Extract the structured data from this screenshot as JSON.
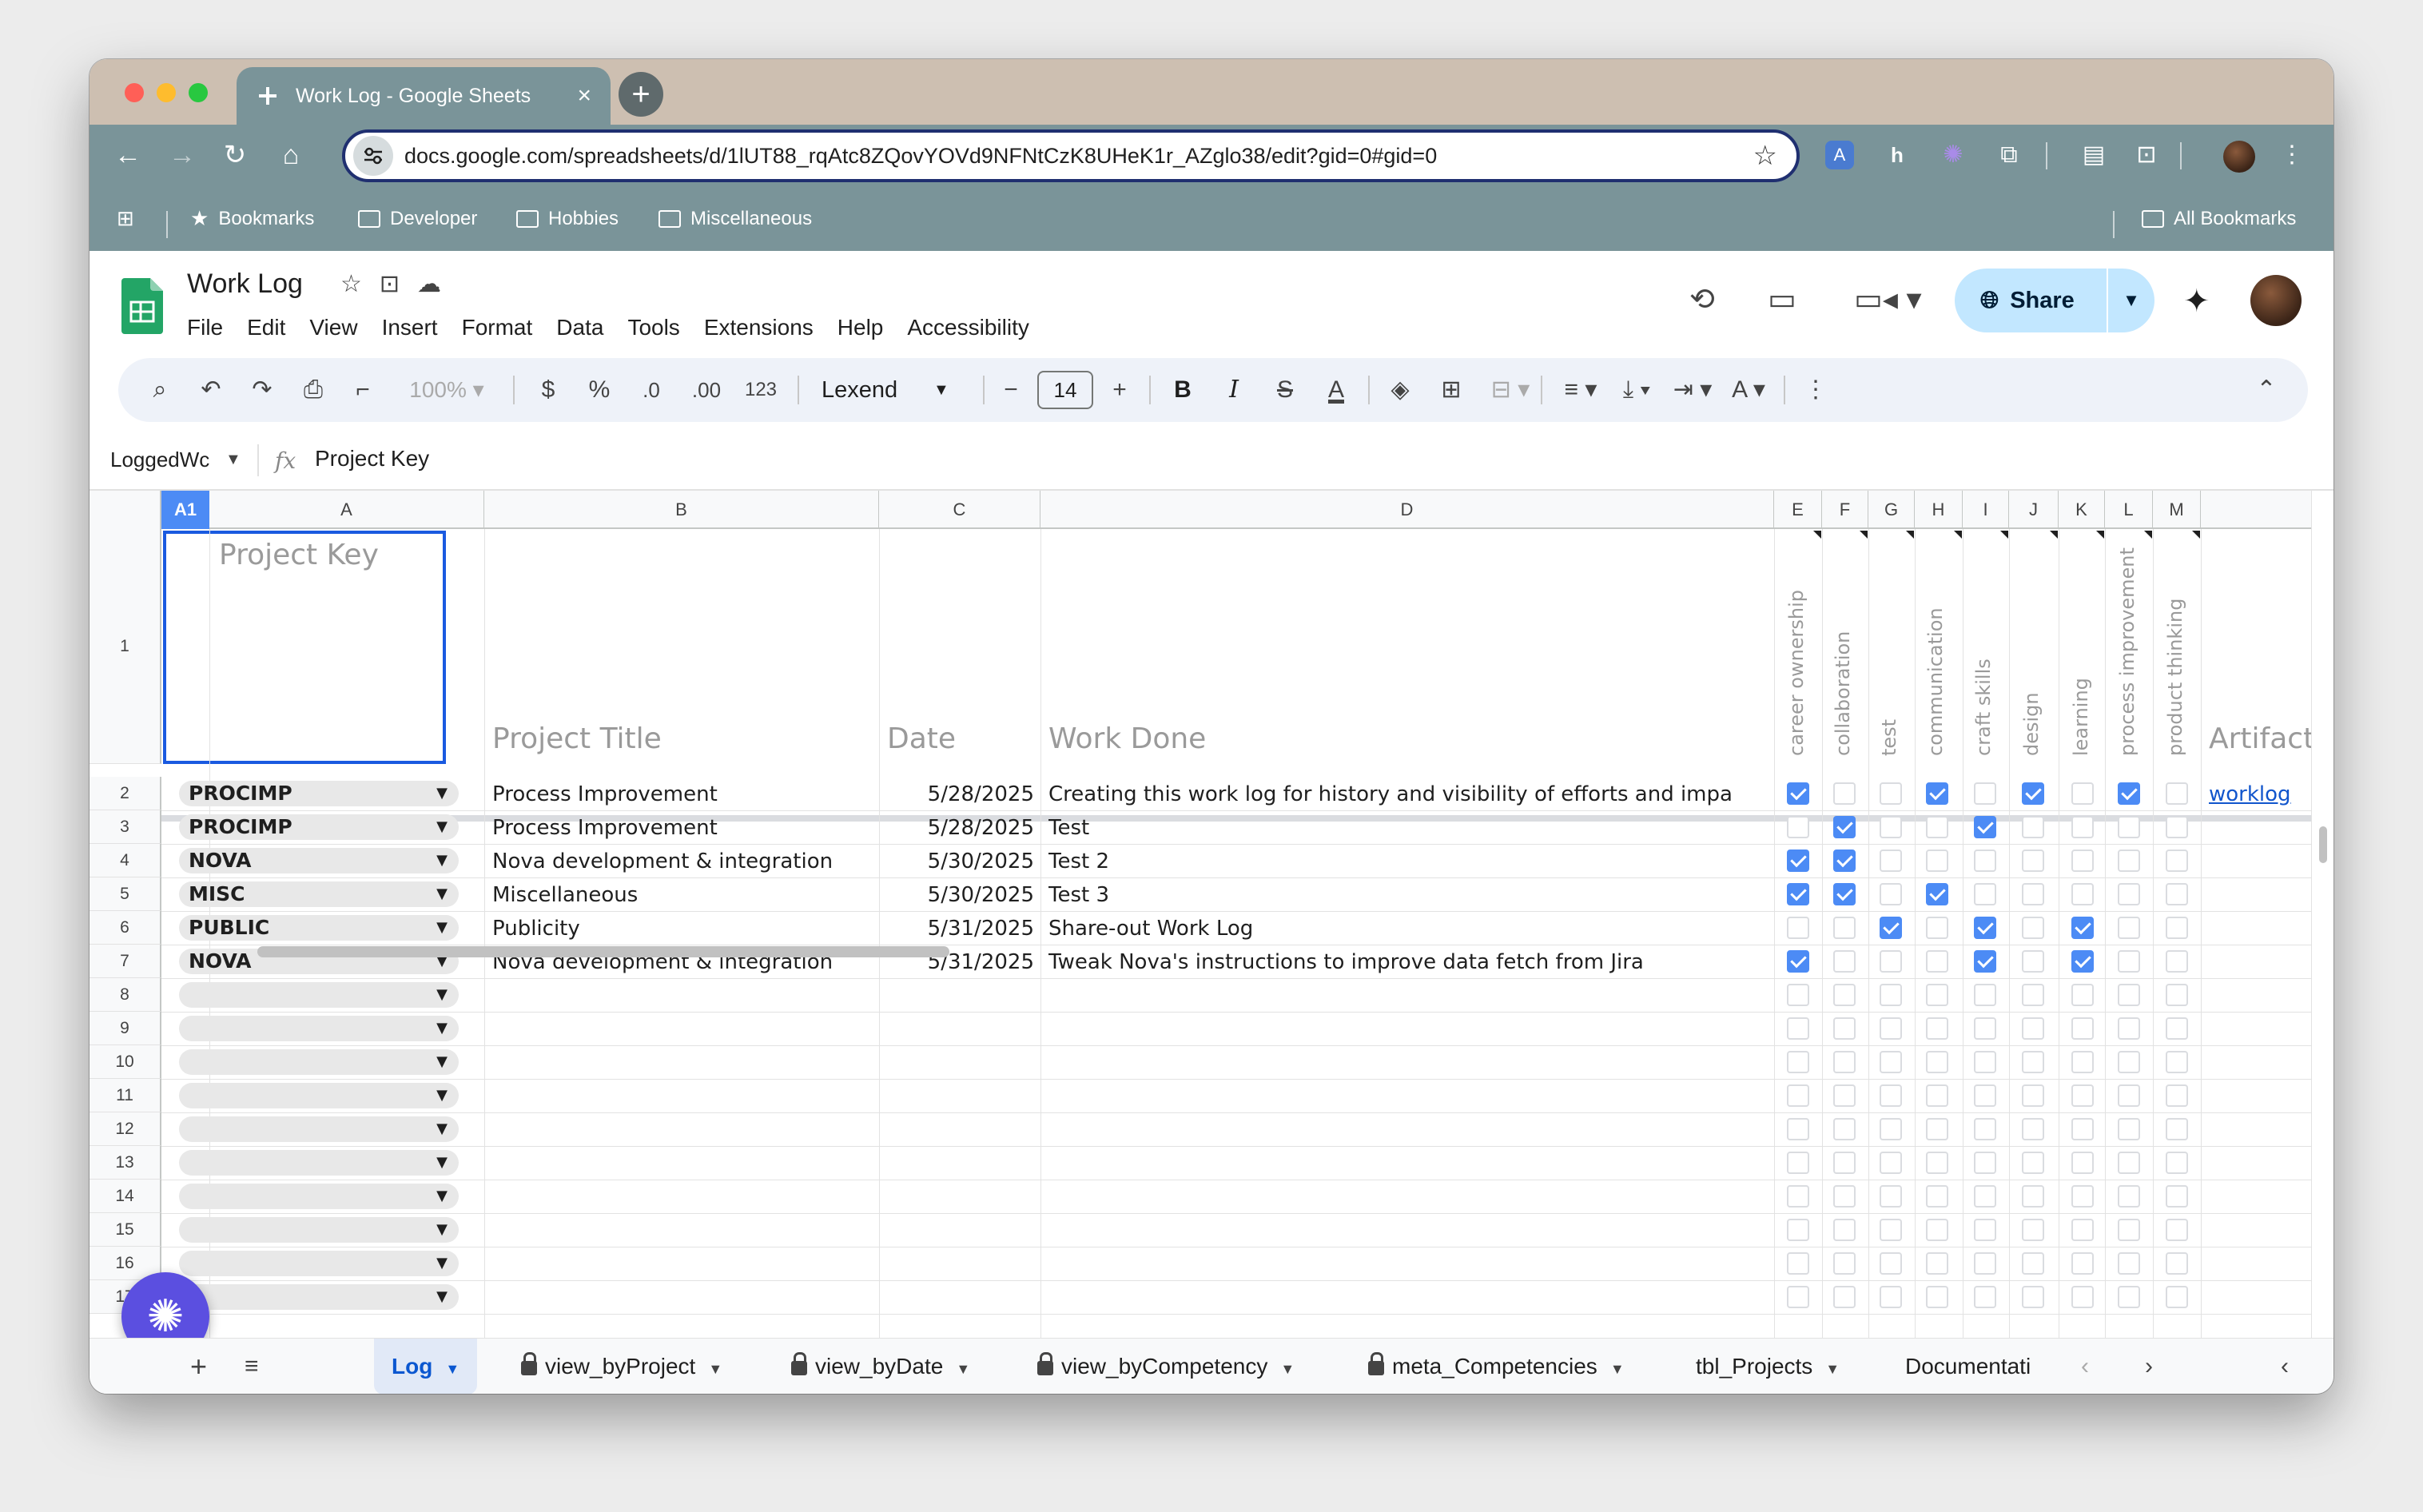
{
  "browser": {
    "tab_title": "Work Log - Google Sheets",
    "url": "docs.google.com/spreadsheets/d/1lUT88_rqAtc8ZQovYOVd9NFNtCzK8UHeK1r_AZglo38/edit?gid=0#gid=0",
    "bookmarks": [
      "Bookmarks",
      "Developer",
      "Hobbies",
      "Miscellaneous"
    ],
    "all_bookmarks": "All Bookmarks"
  },
  "doc": {
    "title": "Work Log",
    "menu": [
      "File",
      "Edit",
      "View",
      "Insert",
      "Format",
      "Data",
      "Tools",
      "Extensions",
      "Help",
      "Accessibility"
    ],
    "share_label": "Share"
  },
  "toolbar": {
    "zoom": "100%",
    "currency": "$",
    "percent": "%",
    "dec_decrease": ".0",
    "dec_increase": ".00",
    "number_format": "123",
    "font": "Lexend",
    "font_size": "14",
    "bold": "B",
    "italic": "I"
  },
  "formula_bar": {
    "name_box": "LoggedWc",
    "formula": "Project Key"
  },
  "grid": {
    "active_cell": "A1",
    "columns": [
      "A",
      "B",
      "C",
      "D",
      "E",
      "F",
      "G",
      "H",
      "I",
      "J",
      "K",
      "L",
      "M"
    ],
    "headers": {
      "project_key": "Project Key",
      "project_title": "Project Title",
      "date": "Date",
      "work_done": "Work Done",
      "artifacts": "Artifacts Gene"
    },
    "competencies": [
      "career ownership",
      "collaboration",
      "test",
      "communication",
      "craft skills",
      "design",
      "learning",
      "process improvement",
      "product thinking"
    ],
    "row_numbers": [
      "1",
      "2",
      "3",
      "4",
      "5",
      "6",
      "7",
      "8",
      "9",
      "10",
      "11",
      "12",
      "13",
      "14",
      "15",
      "16",
      "17"
    ],
    "rows": [
      {
        "key": "PROCIMP",
        "title": "Process Improvement",
        "date": "5/28/2025",
        "work": "Creating this work log for history and visibility of efforts and impa",
        "checks": [
          1,
          0,
          0,
          1,
          0,
          1,
          0,
          1,
          0
        ],
        "artifact": "worklog"
      },
      {
        "key": "PROCIMP",
        "title": "Process Improvement",
        "date": "5/28/2025",
        "work": "Test",
        "checks": [
          0,
          1,
          0,
          0,
          1,
          0,
          0,
          0,
          0
        ],
        "artifact": ""
      },
      {
        "key": "NOVA",
        "title": "Nova development & integration",
        "date": "5/30/2025",
        "work": "Test 2",
        "checks": [
          1,
          1,
          0,
          0,
          0,
          0,
          0,
          0,
          0
        ],
        "artifact": ""
      },
      {
        "key": "MISC",
        "title": "Miscellaneous",
        "date": "5/30/2025",
        "work": "Test 3",
        "checks": [
          1,
          1,
          0,
          1,
          0,
          0,
          0,
          0,
          0
        ],
        "artifact": ""
      },
      {
        "key": "PUBLIC",
        "title": "Publicity",
        "date": "5/31/2025",
        "work": "Share-out Work Log",
        "checks": [
          0,
          0,
          1,
          0,
          1,
          0,
          1,
          0,
          0
        ],
        "artifact": ""
      },
      {
        "key": "NOVA",
        "title": "Nova development & integration",
        "date": "5/31/2025",
        "work": "Tweak Nova's instructions to improve data fetch from Jira",
        "checks": [
          1,
          0,
          0,
          0,
          1,
          0,
          1,
          0,
          0
        ],
        "artifact": ""
      }
    ]
  },
  "sheet_tabs": [
    {
      "label": "Log",
      "locked": false,
      "active": true
    },
    {
      "label": "view_byProject",
      "locked": true,
      "active": false
    },
    {
      "label": "view_byDate",
      "locked": true,
      "active": false
    },
    {
      "label": "view_byCompetency",
      "locked": true,
      "active": false
    },
    {
      "label": "meta_Competencies",
      "locked": true,
      "active": false
    },
    {
      "label": "tbl_Projects",
      "locked": false,
      "active": false
    },
    {
      "label": "Documentati",
      "locked": false,
      "active": false
    }
  ],
  "colors": {
    "chrome": "#7a9499",
    "tabstrip": "#cdbfb1",
    "accent": "#4c8bf5",
    "share_bg": "#c2e7ff",
    "fab": "#5b4fe0"
  }
}
